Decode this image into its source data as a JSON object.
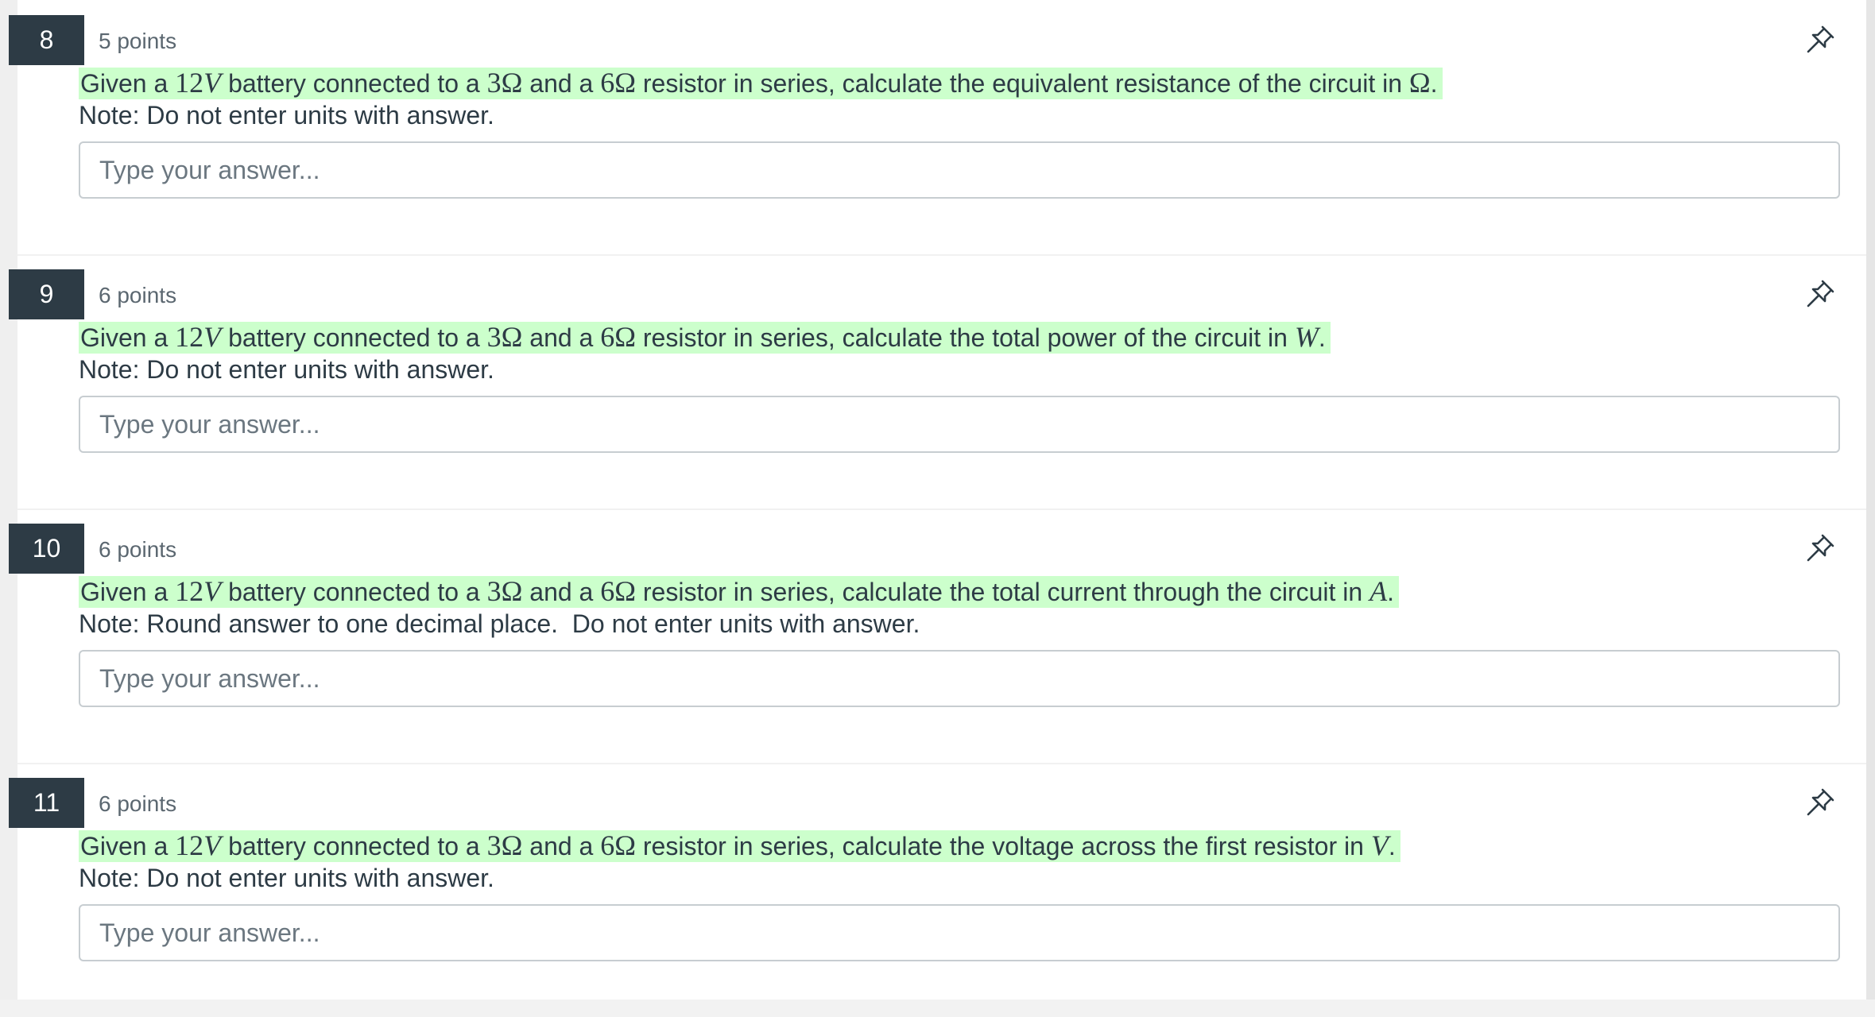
{
  "questions": [
    {
      "number": "8",
      "points": "5 points",
      "prefix": "Given a ",
      "voltage_num": "12",
      "voltage_unit": "V",
      "mid1": " battery connected to a ",
      "r1": "3Ω",
      "mid2": " and a ",
      "r2": "6Ω",
      "rest": " resistor in series, calculate the equivalent resistance of the circuit in ",
      "unit": "Ω",
      "end": ".",
      "note": "Note: Do not enter units with answer.",
      "placeholder": "Type your answer..."
    },
    {
      "number": "9",
      "points": "6 points",
      "prefix": "Given a ",
      "voltage_num": "12",
      "voltage_unit": "V",
      "mid1": " battery connected to a ",
      "r1": "3Ω",
      "mid2": " and a ",
      "r2": "6Ω",
      "rest": " resistor in series, calculate the total power of the circuit in ",
      "unit": "W",
      "end": ".",
      "note": "Note: Do not enter units with answer.",
      "placeholder": "Type your answer..."
    },
    {
      "number": "10",
      "points": "6 points",
      "prefix": "Given a ",
      "voltage_num": "12",
      "voltage_unit": "V",
      "mid1": " battery connected to a ",
      "r1": "3Ω",
      "mid2": " and a ",
      "r2": "6Ω",
      "rest": " resistor in series, calculate the total current through the circuit in ",
      "unit": "A",
      "end": ".",
      "note": "Note: Round answer to one decimal place.  Do not enter units with answer.",
      "placeholder": "Type your answer..."
    },
    {
      "number": "11",
      "points": "6 points",
      "prefix": "Given a ",
      "voltage_num": "12",
      "voltage_unit": "V",
      "mid1": " battery connected to a ",
      "r1": "3Ω",
      "mid2": " and a ",
      "r2": "6Ω",
      "rest": " resistor in series, calculate the voltage across the first resistor in ",
      "unit": "V",
      "end": ".",
      "note": "Note: Do not enter units with answer.",
      "placeholder": "Type your answer..."
    }
  ],
  "icons": {
    "pin": "pin-icon"
  },
  "colors": {
    "highlight": "#ccffcc",
    "number_badge": "#2d3b45",
    "text": "#2d3b45"
  }
}
